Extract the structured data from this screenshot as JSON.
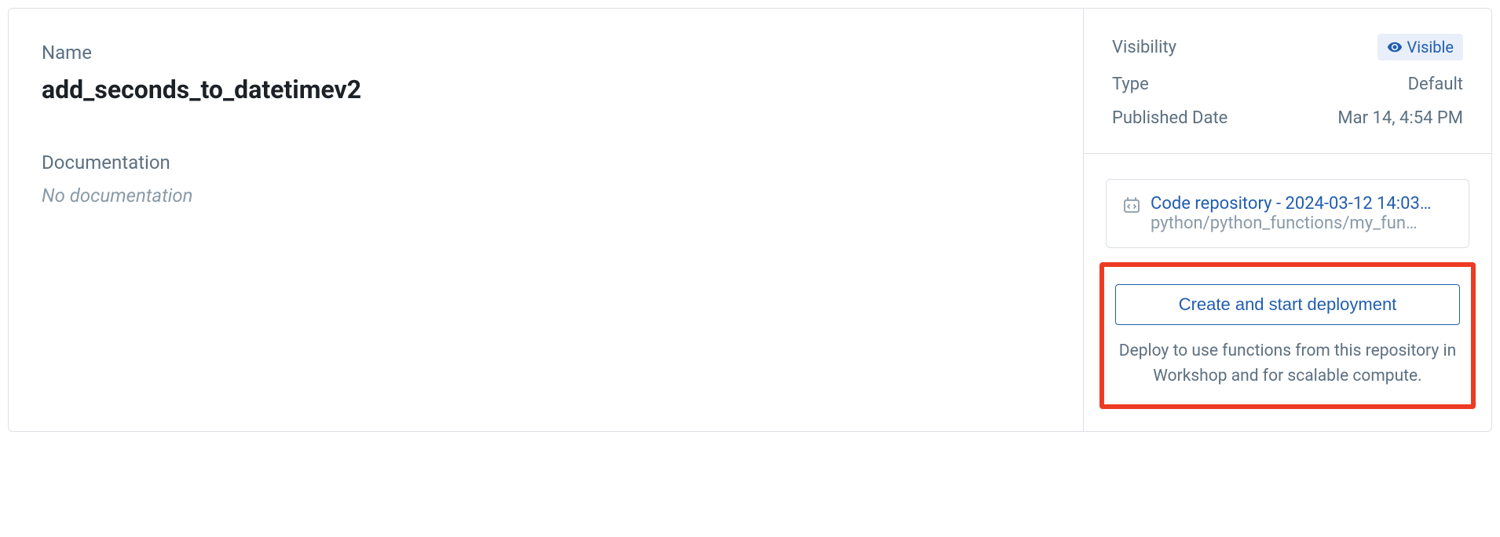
{
  "main": {
    "name_label": "Name",
    "name_value": "add_seconds_to_datetimev2",
    "documentation_label": "Documentation",
    "documentation_empty": "No documentation"
  },
  "sidebar": {
    "meta": {
      "visibility_label": "Visibility",
      "visibility_value": "Visible",
      "type_label": "Type",
      "type_value": "Default",
      "published_label": "Published Date",
      "published_value": "Mar 14, 4:54 PM"
    },
    "repo": {
      "title": "Code repository - 2024-03-12 14:03…",
      "path": "python/python_functions/my_fun…"
    },
    "deploy": {
      "button": "Create and start deployment",
      "description": "Deploy to use functions from this repository in Workshop and for scalable compute."
    }
  }
}
